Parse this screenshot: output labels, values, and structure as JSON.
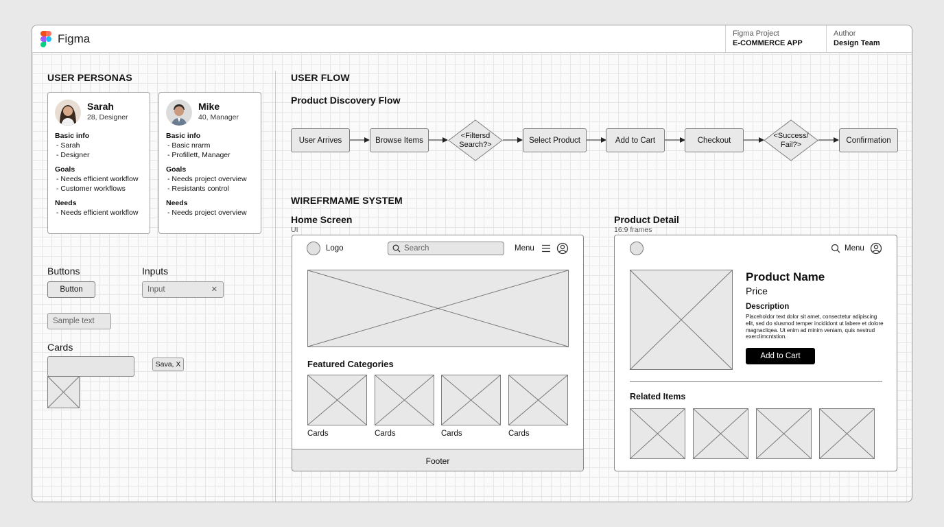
{
  "app": {
    "name": "Figma"
  },
  "header": {
    "project_label": "Figma Project",
    "project_value": "E-COMMERCE APP",
    "author_label": "Author",
    "author_value": "Design Team"
  },
  "personas_section": {
    "title": "USER PERSONAS",
    "personas": [
      {
        "name": "Sarah",
        "sub": "28, Designer",
        "basic_label": "Basic info",
        "basic": [
          "- Sarah",
          "- Designer"
        ],
        "goals_label": "Goals",
        "goals": [
          "- Needs efficient workflow",
          "- Customer workflows"
        ],
        "needs_label": "Needs",
        "needs": [
          "- Needs efficient workflow"
        ]
      },
      {
        "name": "Mike",
        "sub": "40, Manager",
        "basic_label": "Basic info",
        "basic": [
          "- Basic nrarm",
          "- Profillett, Manager"
        ],
        "goals_label": "Goals",
        "goals": [
          "- Needs project overview",
          "- Resistants control"
        ],
        "needs_label": "Needs",
        "needs": [
          "- Needs project overview"
        ]
      }
    ]
  },
  "components": {
    "buttons_title": "Buttons",
    "button_label": "Button",
    "inputs_title": "Inputs",
    "input_placeholder": "Input",
    "input_clear": "✕",
    "sample_text": "Sample text",
    "cards_title": "Cards",
    "save_tag": "Sava, X"
  },
  "user_flow": {
    "title": "USER FLOW",
    "subtitle": "Product Discovery Flow",
    "steps": [
      "User Arrives",
      "Browse Items",
      "<Filtersd\nSearch?>",
      "Select Product",
      "Add to Cart",
      "Checkout",
      "<Success/\nFail?>",
      "Confirmation"
    ]
  },
  "wireframe": {
    "title": "WIREFRMAME SYSTEM",
    "home": {
      "title": "Home Screen",
      "caption": "UI",
      "logo": "Logo",
      "search_placeholder": "Search",
      "menu": "Menu",
      "featured": "Featured Categories",
      "cards": [
        "Cards",
        "Cards",
        "Cards",
        "Cards"
      ],
      "footer": "Footer"
    },
    "detail": {
      "title": "Product Detail",
      "caption": "16:9 frames",
      "menu": "Menu",
      "product_name": "Product Name",
      "price": "Price",
      "description_label": "Description",
      "description": "Placeholdor text dolor sit amet, consectetur adipiscing elit, sed do slusmod temper incididont ut labere et dolore magnacliqea. Ut enim ad minim veniam, quis nestrud exerclimcntstion.",
      "add_to_cart": "Add to Cart",
      "related": "Related Items"
    }
  },
  "colors": {
    "accent_black": "#000000",
    "placeholder_fill": "#e8e8e8"
  },
  "icons": [
    "figma-logo-icon",
    "search-icon",
    "hamburger-icon",
    "user-icon",
    "close-icon",
    "arrow-right-icon"
  ]
}
